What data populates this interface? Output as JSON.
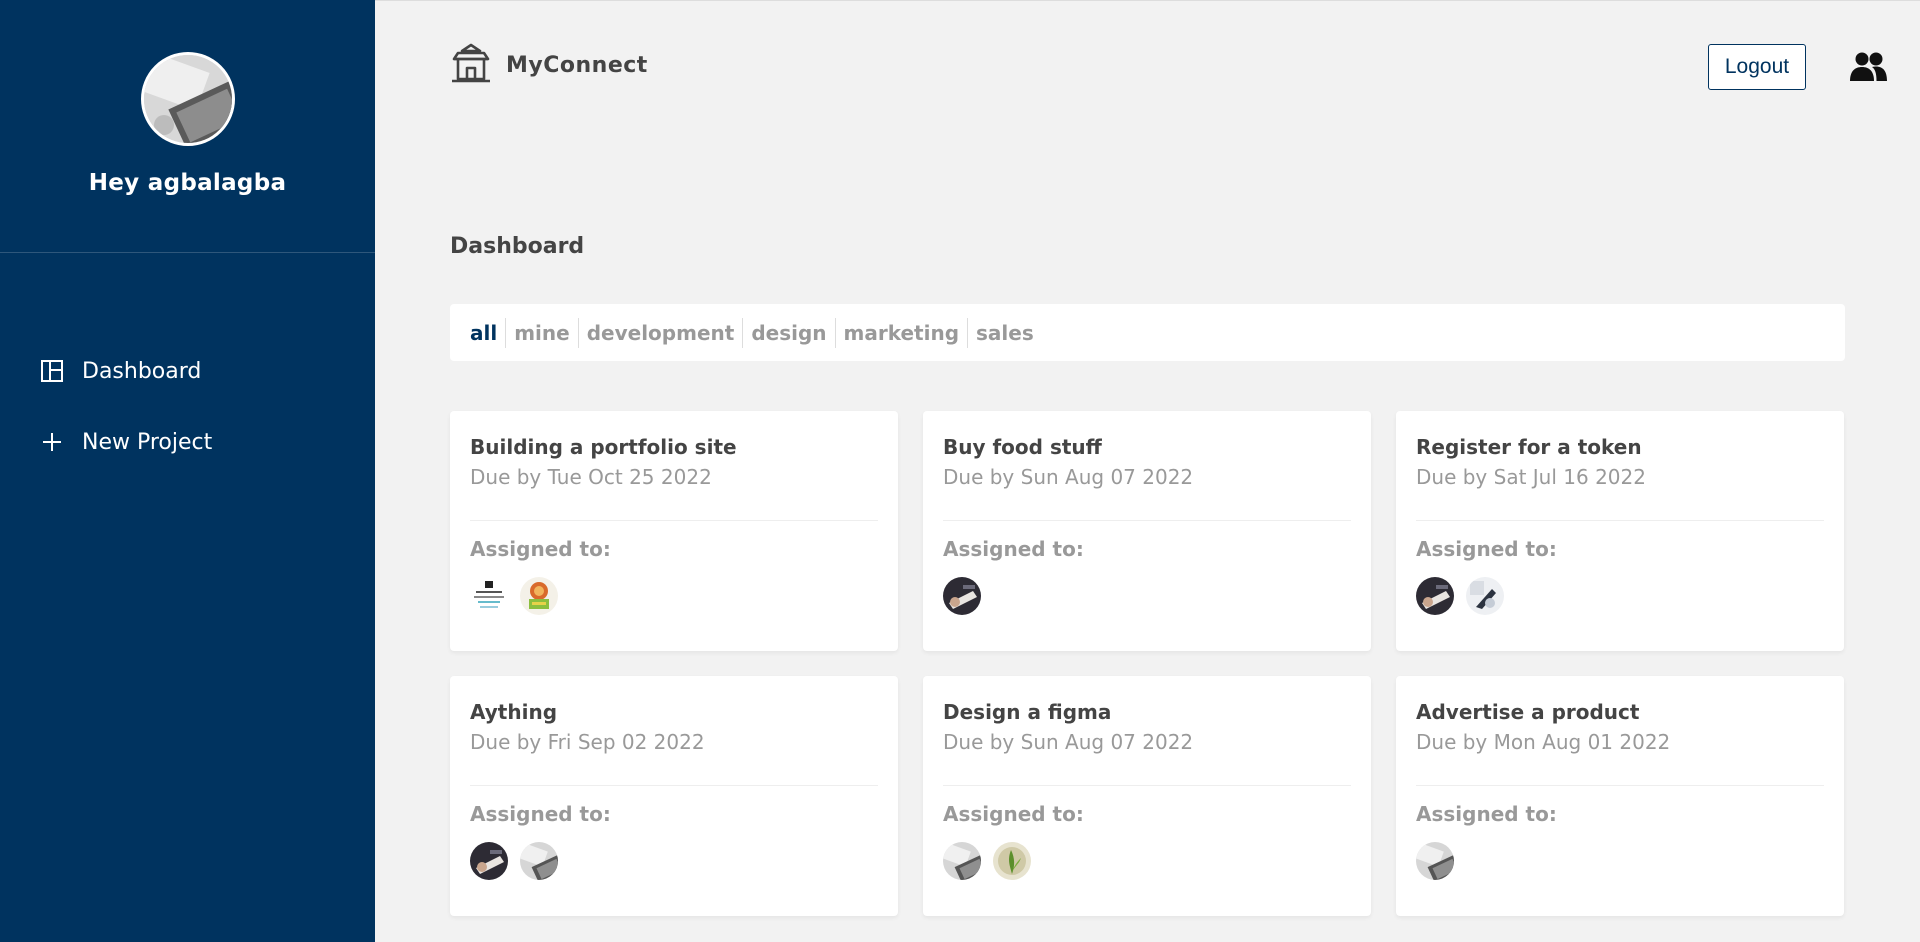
{
  "sidebar": {
    "greeting": "Hey agbalagba",
    "nav": [
      {
        "label": "Dashboard",
        "icon": "dashboard-icon"
      },
      {
        "label": "New Project",
        "icon": "plus-icon"
      }
    ]
  },
  "header": {
    "brand": "MyConnect",
    "logout_label": "Logout",
    "icons": {
      "brand": "temple-icon",
      "users": "users-icon"
    }
  },
  "main": {
    "title": "Dashboard",
    "filters": [
      "all",
      "mine",
      "development",
      "design",
      "marketing",
      "sales"
    ],
    "active_filter": "all",
    "projects": [
      {
        "title": "Building a portfolio site",
        "due": "Due by Tue Oct 25 2022",
        "assigned_label": "Assigned to:",
        "assignees": [
          "doc",
          "food"
        ]
      },
      {
        "title": "Buy food stuff",
        "due": "Due by Sun Aug 07 2022",
        "assigned_label": "Assigned to:",
        "assignees": [
          "hands"
        ]
      },
      {
        "title": "Register for a token",
        "due": "Due by Sat Jul 16 2022",
        "assigned_label": "Assigned to:",
        "assignees": [
          "hands",
          "light"
        ]
      },
      {
        "title": "Aything",
        "due": "Due by Fri Sep 02 2022",
        "assigned_label": "Assigned to:",
        "assignees": [
          "hands",
          "desk"
        ]
      },
      {
        "title": "Design a figma",
        "due": "Due by Sun Aug 07 2022",
        "assigned_label": "Assigned to:",
        "assignees": [
          "desk",
          "plant"
        ]
      },
      {
        "title": "Advertise a product",
        "due": "Due by Mon Aug 01 2022",
        "assigned_label": "Assigned to:",
        "assignees": [
          "desk"
        ]
      }
    ]
  },
  "colors": {
    "sidebar": "#00335f",
    "background": "#f2f2f2",
    "accent": "#00335f",
    "muted": "#999999"
  }
}
